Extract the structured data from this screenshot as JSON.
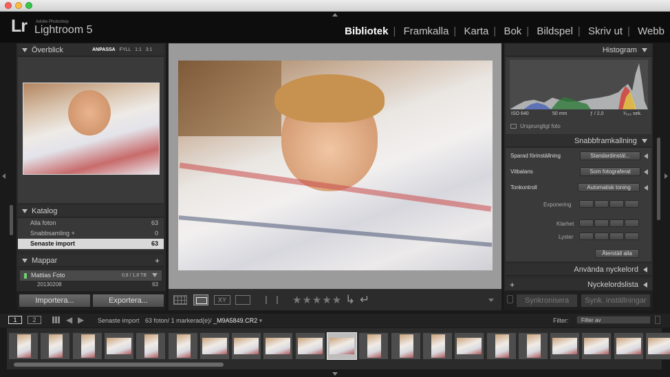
{
  "window": {
    "brand_small": "Adobe Photoshop",
    "brand_name": "Lightroom 5",
    "logo": "Lr"
  },
  "modules": [
    "Bibliotek",
    "Framkalla",
    "Karta",
    "Bok",
    "Bildspel",
    "Skriv ut",
    "Webb"
  ],
  "left": {
    "overview": {
      "title": "Överblick",
      "options": [
        "ANPASSA",
        "FYLL",
        "1:1",
        "3:1"
      ]
    },
    "catalog": {
      "title": "Katalog",
      "items": [
        {
          "label": "Alla foton",
          "count": "63"
        },
        {
          "label": "Snabbsamling +",
          "count": "0"
        },
        {
          "label": "Senaste import",
          "count": "63"
        }
      ]
    },
    "folders": {
      "title": "Mappar",
      "add": "+",
      "volume": {
        "label": "Mattias Foto",
        "size": "0,8 / 1,8 TB"
      },
      "folder": {
        "label": "20130208",
        "count": "63"
      }
    },
    "import_label": "Importera...",
    "export_label": "Exportera..."
  },
  "right": {
    "histogram": {
      "title": "Histogram",
      "iso": "ISO 640",
      "focal": "50 mm",
      "aperture": "ƒ / 2,0",
      "shutter": "¹⁄₅₀₀ sek.",
      "original_label": "Ursprungligt foto"
    },
    "quick_develop": {
      "title": "Snabbframkallning",
      "saved_preset_label": "Sparad förinställning",
      "saved_preset_value": "Standardinstäl...",
      "wb_label": "Vitbalans",
      "wb_value": "Som fotograferat",
      "tone_label": "Tonkontroll",
      "auto_tone": "Automatisk toning",
      "exposure_label": "Exponering",
      "clarity_label": "Klarhet",
      "vibrance_label": "Lyster",
      "reset": "Återställ alla"
    },
    "keywording": {
      "title": "Använda nyckelord"
    },
    "keyword_list": {
      "title": "Nyckelordslista",
      "add": "+"
    },
    "sync_label": "Synkronisera",
    "sync_settings_label": "Synk. inställningar"
  },
  "filmstrip_bar": {
    "view1": "1",
    "view2": "2",
    "source": "Senaste import",
    "info": "63 foton/ 1 markerad(e)/",
    "filename": "_M9A5849.CR2",
    "filter_label": "Filter:",
    "filter_value": "Filter av"
  },
  "toolbar": {
    "rating": "★★★★★"
  },
  "filmstrip": {
    "count": 21,
    "selected_index": 10
  },
  "colors": {
    "accent": "#ffffff",
    "panel": "#3b3b3b",
    "background": "#1a1a1a"
  }
}
